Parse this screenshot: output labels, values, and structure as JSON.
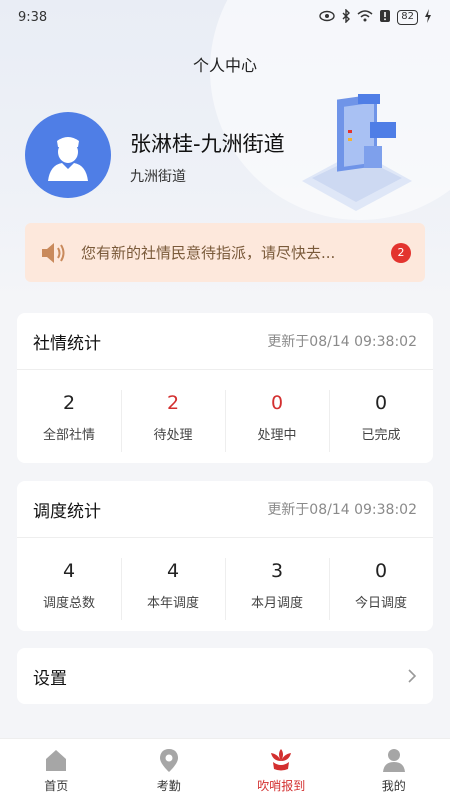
{
  "status_bar": {
    "time": "9:38",
    "battery": "82"
  },
  "page": {
    "title": "个人中心"
  },
  "user": {
    "name": "张淋桂-九洲街道",
    "organization": "九洲街道"
  },
  "notice": {
    "text": "您有新的社情民意待指派，请尽快去...",
    "badge": "2"
  },
  "social_stats": {
    "title": "社情统计",
    "updated": "更新于08/14 09:38:02",
    "items": [
      {
        "value": "2",
        "label": "全部社情",
        "highlight": false
      },
      {
        "value": "2",
        "label": "待处理",
        "highlight": true
      },
      {
        "value": "0",
        "label": "处理中",
        "highlight": true
      },
      {
        "value": "0",
        "label": "已完成",
        "highlight": false
      }
    ]
  },
  "dispatch_stats": {
    "title": "调度统计",
    "updated": "更新于08/14 09:38:02",
    "items": [
      {
        "value": "4",
        "label": "调度总数"
      },
      {
        "value": "4",
        "label": "本年调度"
      },
      {
        "value": "3",
        "label": "本月调度"
      },
      {
        "value": "0",
        "label": "今日调度"
      }
    ]
  },
  "settings": {
    "label": "设置"
  },
  "nav": [
    {
      "label": "首页",
      "icon": "home-icon",
      "active": false
    },
    {
      "label": "考勤",
      "icon": "location-pin-icon",
      "active": false
    },
    {
      "label": "吹哨报到",
      "icon": "flower-icon",
      "active": true
    },
    {
      "label": "我的",
      "icon": "person-icon",
      "active": false
    }
  ],
  "colors": {
    "accent_red": "#d32f2f",
    "avatar_blue": "#4f7ee6",
    "notice_bg": "#fde8dc"
  }
}
